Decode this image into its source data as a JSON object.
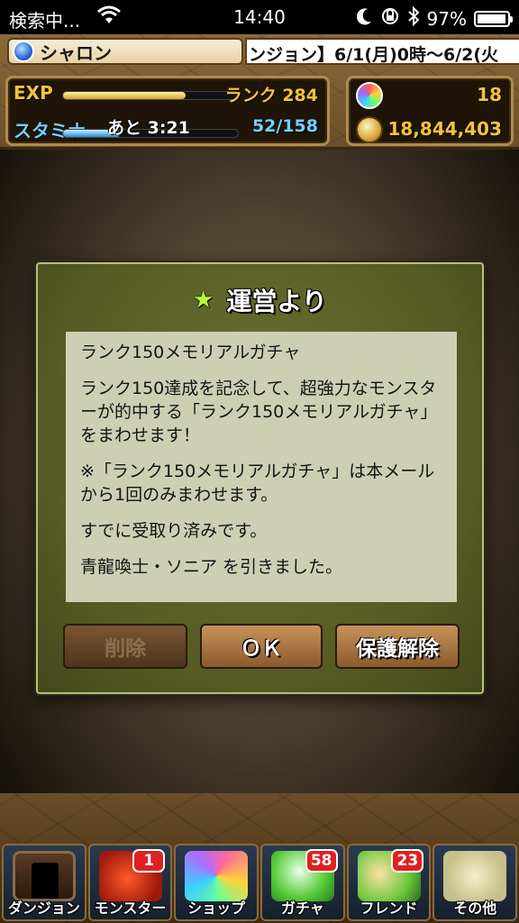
{
  "status_bar": {
    "carrier": "検索中...",
    "time": "14:40",
    "battery": "97%",
    "battery_level": 0.97,
    "icons": [
      "wifi-icon",
      "moon-icon",
      "orientation-lock-icon",
      "bluetooth-icon"
    ]
  },
  "hud": {
    "player_name": "シャロン",
    "ticker": "ンジョン】6/1(月)0時～6/2(火",
    "exp_label": "EXP",
    "exp_progress": 0.7,
    "rank": "ランク 284",
    "stamina_label": "スタミナ",
    "stamina_timer": "あと 3:21",
    "stamina_value": "52/158",
    "stamina_progress": 0.33,
    "magic_stones": "18",
    "coins": "18,844,403"
  },
  "modal": {
    "title": "運営より",
    "star": "★",
    "message": [
      "ランク150メモリアルガチャ",
      "ランク150達成を記念して、超強力なモンスターが的中する「ランク150メモリアルガチャ」をまわせます！",
      "※「ランク150メモリアルガチャ」は本メールから1回のみまわせます。",
      "すでに受取り済みです。",
      "青龍喚士・ソニア を引きました。"
    ],
    "buttons": {
      "delete": "削除",
      "ok": "ＯＫ",
      "unprotect": "保護解除"
    }
  },
  "nav": [
    {
      "label": "ダンジョン",
      "icon": "dungeon-icon",
      "badge": ""
    },
    {
      "label": "モンスター",
      "icon": "monster-icon",
      "badge": "1"
    },
    {
      "label": "ショップ",
      "icon": "shop-icon",
      "badge": ""
    },
    {
      "label": "ガチャ",
      "icon": "gacha-icon",
      "badge": "58"
    },
    {
      "label": "フレンド",
      "icon": "friend-icon",
      "badge": "23"
    },
    {
      "label": "その他",
      "icon": "other-icon",
      "badge": ""
    }
  ]
}
